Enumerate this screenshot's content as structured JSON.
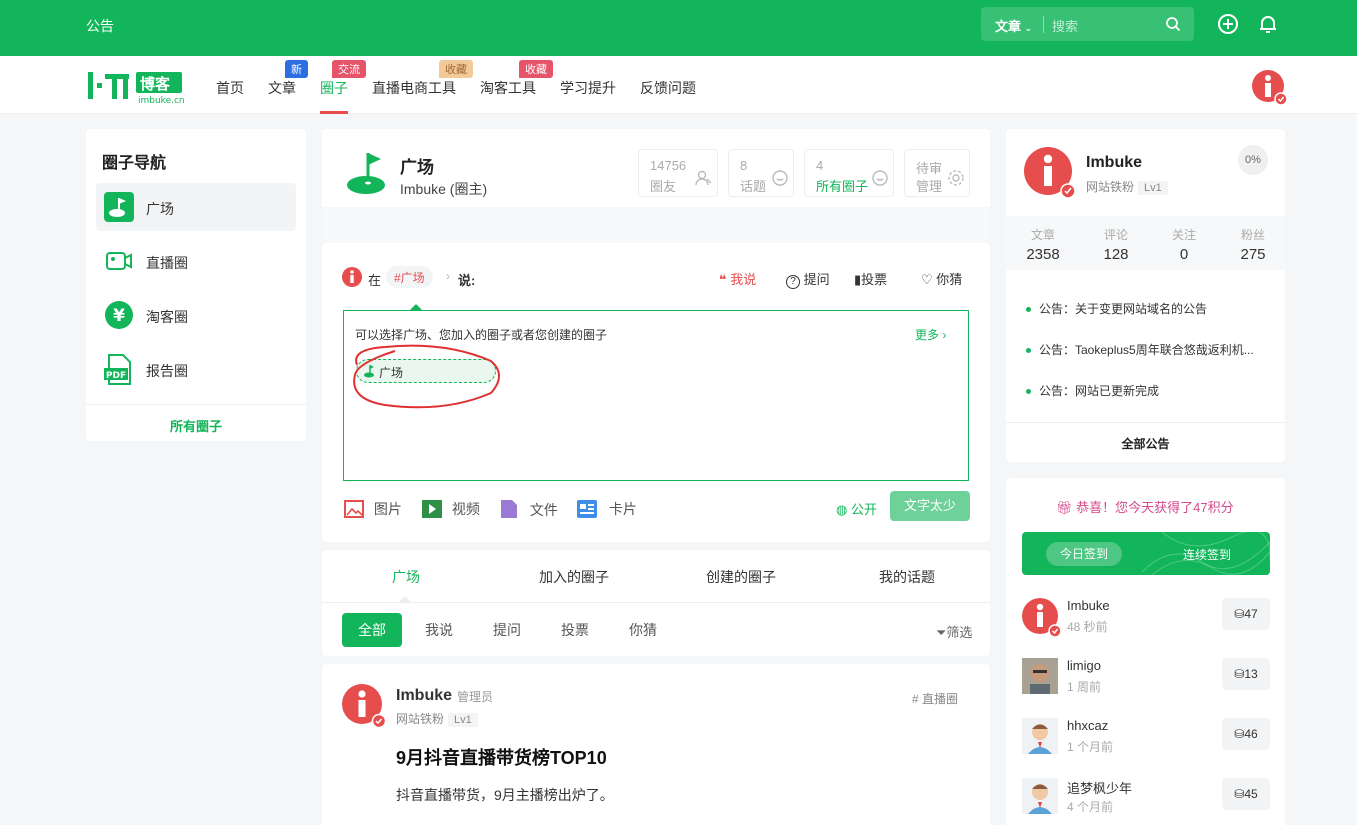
{
  "topbar": {
    "notice": "公告",
    "search_scope": "文章",
    "search_placeholder": "搜索"
  },
  "nav": {
    "items": [
      "首页",
      "文章",
      "圈子",
      "直播电商工具",
      "淘客工具",
      "学习提升",
      "反馈问题"
    ],
    "badges": {
      "article": "新",
      "circle": "交流",
      "live": "收藏",
      "taoke": "收藏"
    }
  },
  "leftnav": {
    "title": "圈子导航",
    "items": [
      "广场",
      "直播圈",
      "淘客圈",
      "报告圈"
    ],
    "all": "所有圈子"
  },
  "circle": {
    "name": "广场",
    "owner": "Imbuke (圈主)",
    "stats": [
      {
        "num": "14756",
        "label": "圈友"
      },
      {
        "num": "8",
        "label": "话题"
      },
      {
        "num": "4",
        "label": "所有圈子"
      },
      {
        "num": "待审",
        "label": "管理"
      }
    ]
  },
  "composer": {
    "at": "在",
    "tag": "#广场",
    "say": "说:",
    "types": [
      "我说",
      "提问",
      "投票",
      "你猜"
    ],
    "hint": "可以选择广场、您加入的圈子或者您创建的圈子",
    "more": "更多 ›",
    "chip": "广场",
    "tools": [
      "图片",
      "视频",
      "文件",
      "卡片"
    ],
    "public": "公开",
    "submit": "文字太少"
  },
  "tabs": [
    "广场",
    "加入的圈子",
    "创建的圈子",
    "我的话题"
  ],
  "filters": [
    "全部",
    "我说",
    "提问",
    "投票",
    "你猜"
  ],
  "screen": "筛选",
  "post": {
    "user": "Imbuke",
    "role": "管理员",
    "sub": "网站铁粉",
    "lvl": "Lv1",
    "tag": "# 直播圈",
    "title": "9月抖音直播带货榜TOP10",
    "body": "抖音直播带货，9月主播榜出炉了。"
  },
  "profile": {
    "name": "Imbuke",
    "sub": "网站铁粉",
    "lvl": "Lv1",
    "pct": "0%",
    "stats": [
      {
        "k": "文章",
        "v": "2358"
      },
      {
        "k": "评论",
        "v": "128"
      },
      {
        "k": "关注",
        "v": "0"
      },
      {
        "k": "粉丝",
        "v": "275"
      }
    ],
    "notices": [
      "公告：关于变更网站域名的公告",
      "公告：Taokeplus5周年联合悠哉返利机...",
      "公告：网站已更新完成"
    ],
    "all_notice": "全部公告"
  },
  "signin": {
    "congrats": "恭喜！您今天获得了47积分",
    "today": "今日签到",
    "continuous": "连续签到",
    "rows": [
      {
        "name": "Imbuke",
        "time": "48 秒前",
        "pts": "47"
      },
      {
        "name": "limigo",
        "time": "1 周前",
        "pts": "13"
      },
      {
        "name": "hhxcaz",
        "time": "1 个月前",
        "pts": "46"
      },
      {
        "name": "追梦枫少年",
        "time": "4 个月前",
        "pts": "45"
      }
    ]
  },
  "colors": {
    "brand": "#12b55a",
    "accent": "#e64d4d"
  }
}
